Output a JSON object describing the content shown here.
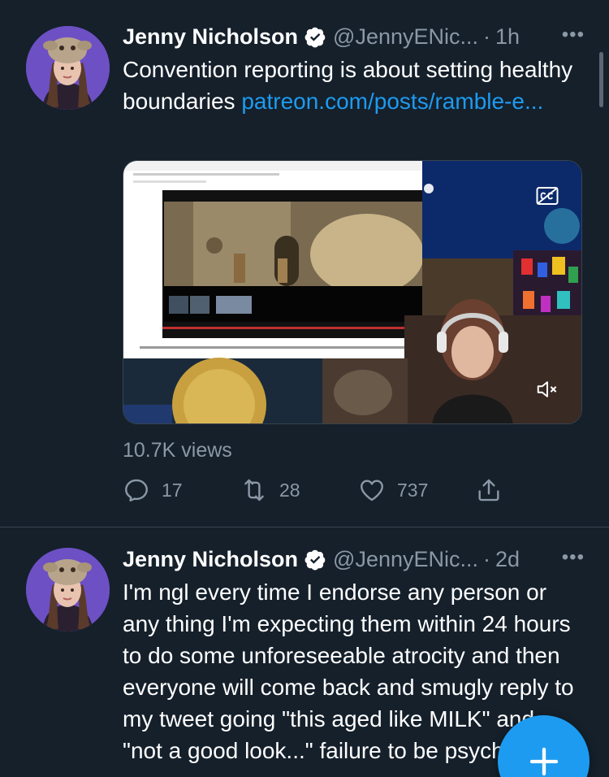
{
  "tweets": [
    {
      "author_name": "Jenny Nicholson",
      "handle": "@JennyENic...",
      "separator": "·",
      "time": "1h",
      "more": "•••",
      "text": "Convention reporting is about setting healthy boundaries ",
      "link": "patreon.com/posts/ramble-e...",
      "views": "10.7K views",
      "replies": "17",
      "retweets": "28",
      "likes": "737"
    },
    {
      "author_name": "Jenny Nicholson",
      "handle": "@JennyENic...",
      "separator": "·",
      "time": "2d",
      "more": "•••",
      "text": "I'm ngl every time I endorse any person or any thing I'm expecting them within 24 hours to do some unforeseeable atrocity and then everyone will come back and smugly reply to my tweet going \"this aged like MILK\" and \"not a good look...\" failure to be psychic"
    }
  ],
  "colors": {
    "background": "#15202b",
    "accent": "#1d9bf0",
    "secondary_text": "#8b98a5",
    "divider": "#38444d"
  },
  "icons": {
    "verified": "verified-badge-icon",
    "reply": "reply-icon",
    "retweet": "retweet-icon",
    "like": "heart-icon",
    "share": "share-icon",
    "captions": "closed-captions-icon",
    "mute": "mute-icon",
    "compose": "plus-icon"
  }
}
